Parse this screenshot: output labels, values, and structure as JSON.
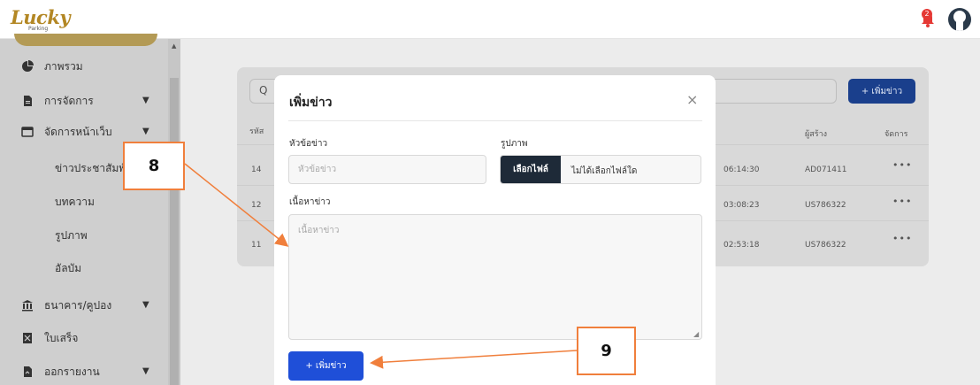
{
  "header": {
    "logo_text": "Lucky",
    "logo_sub": "Parking",
    "notification_count": "2",
    "accent_color": "#b38724"
  },
  "sidebar": {
    "items": [
      {
        "label": "ภาพรวม",
        "icon": "pie-chart-icon"
      },
      {
        "label": "การจัดการ",
        "icon": "document-icon",
        "expandable": true
      },
      {
        "label": "จัดการหน้าเว็บ",
        "icon": "window-icon",
        "expandable": true
      },
      {
        "label": "ธนาคาร/คูปอง",
        "icon": "bank-icon",
        "expandable": true
      },
      {
        "label": "ใบเสร็จ",
        "icon": "receipt-icon"
      },
      {
        "label": "ออกรายงาน",
        "icon": "report-icon",
        "expandable": true
      }
    ],
    "subitems": [
      {
        "label": "ข่าวประชาสัมพันธ์"
      },
      {
        "label": "บทความ"
      },
      {
        "label": "รูปภาพ"
      },
      {
        "label": "อัลบัม"
      }
    ]
  },
  "background": {
    "add_button": "+ เพิ่มข่าว",
    "columns": [
      "รหัส",
      "ผู้สร้าง",
      "จัดการ"
    ],
    "rows": [
      {
        "id": "14",
        "time": "06:14:30",
        "creator": "AD071411"
      },
      {
        "id": "12",
        "time": "03:08:23",
        "creator": "US786322"
      },
      {
        "id": "11",
        "time": "02:53:18",
        "creator": "US786322"
      }
    ],
    "actions_glyph": "•••"
  },
  "modal": {
    "title": "เพิ่มข่าว",
    "close": "×",
    "headline_label": "หัวข้อข่าว",
    "headline_placeholder": "หัวข้อข่าว",
    "image_label": "รูปภาพ",
    "file_button": "เลือกไฟล์",
    "file_status": "ไม่ได้เลือกไฟล์ใด",
    "content_label": "เนื้อหาข่าว",
    "content_placeholder": "เนื้อหาข่าว",
    "submit_label": "+ เพิ่มข่าว",
    "submit_color": "#1f4fd8"
  },
  "annotations": {
    "box_8": "8",
    "box_9": "9",
    "color": "#f07f3c"
  }
}
